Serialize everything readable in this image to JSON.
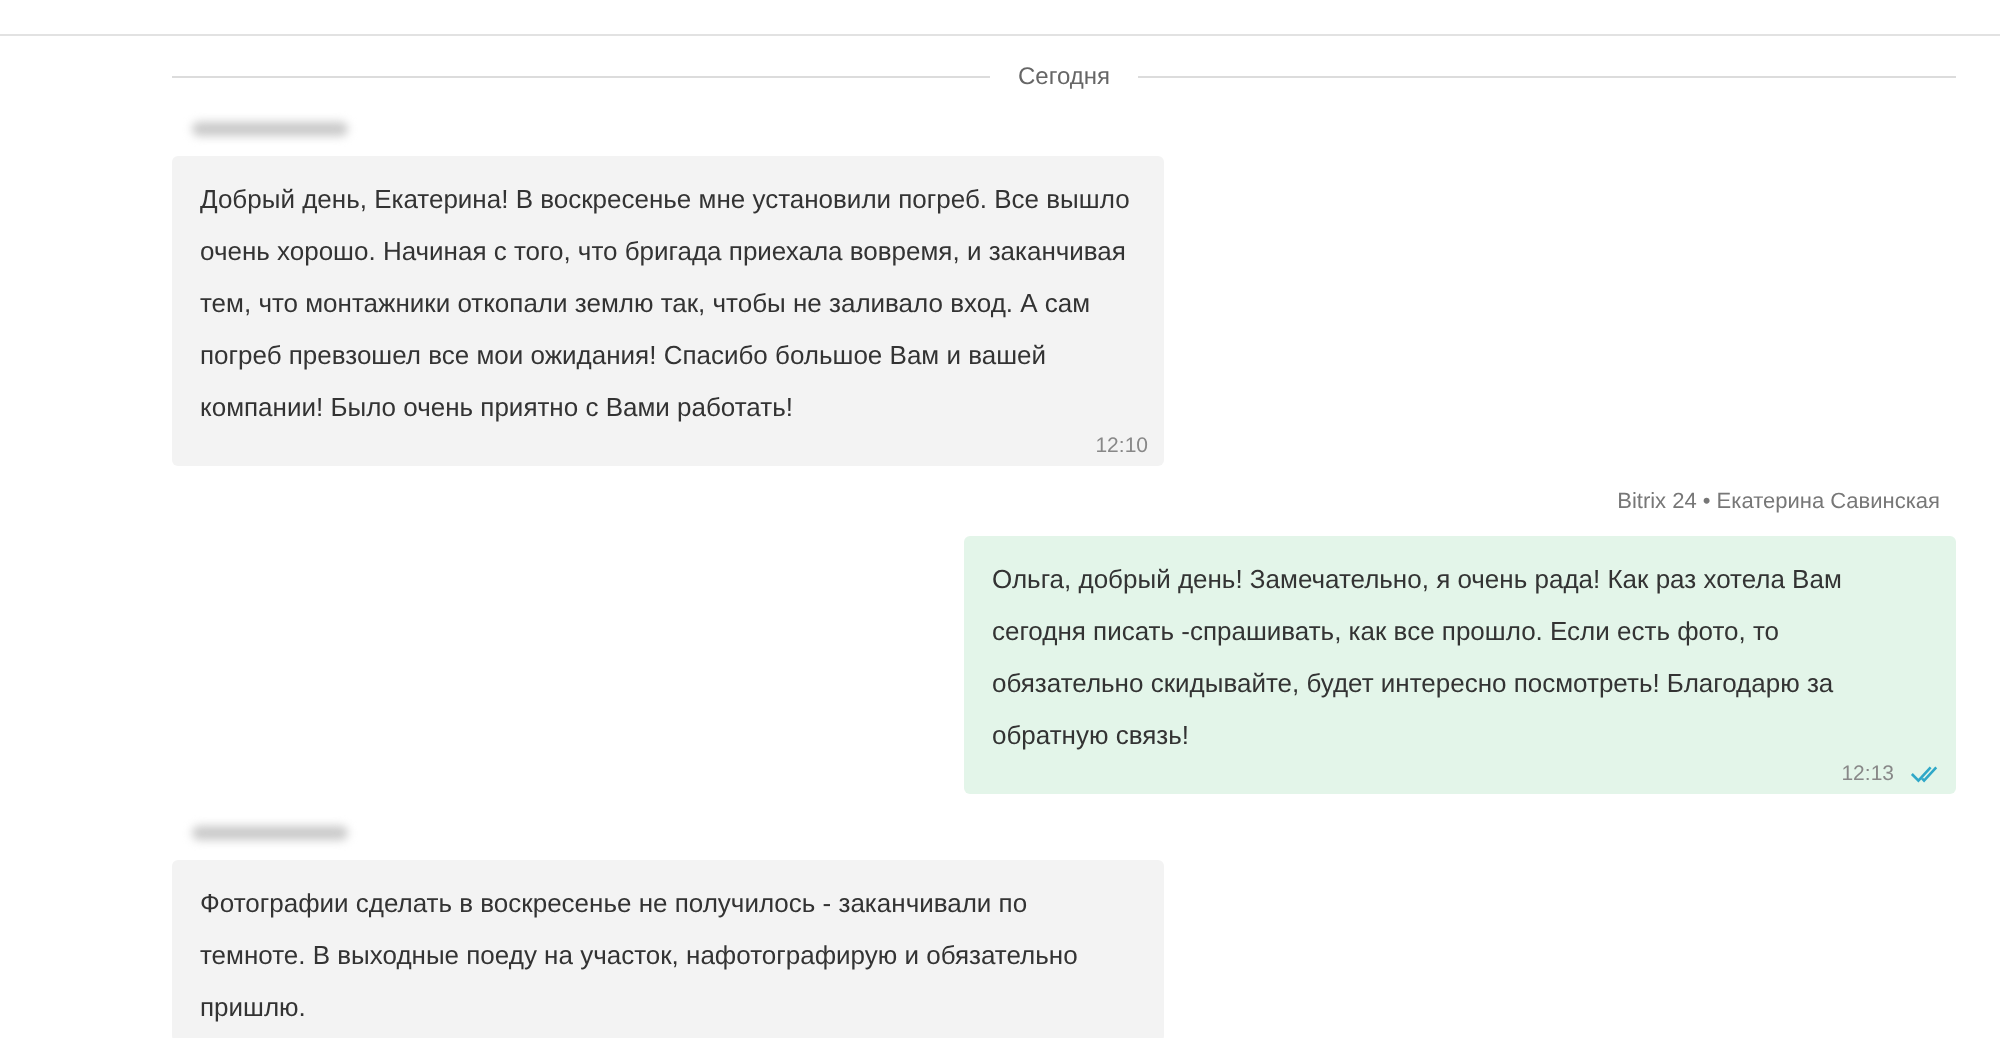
{
  "date_divider": "Сегодня",
  "messages": [
    {
      "kind": "incoming",
      "sender_blurred": true,
      "text": "Добрый день, Екатерина! В воскресенье мне установили погреб. Все вышло очень хорошо. Начиная с того, что бригада приехала вовремя, и заканчивая тем, что монтажники откопали землю так, чтобы не заливало вход. А сам погреб превзошел все мои ожидания! Спасибо большое Вам и вашей компании! Было очень приятно с Вами работать!",
      "time": "12:10"
    },
    {
      "kind": "outgoing",
      "author": "Bitrix 24 • Екатерина Савинская",
      "text": "Ольга, добрый день! Замечательно, я очень рада! Как раз хотела Вам сегодня писать -спрашивать, как все прошло. Если есть фото, то обязательно скидывайте, будет интересно посмотреть! Благодарю за обратную связь!",
      "time": "12:13",
      "read": true
    },
    {
      "kind": "incoming",
      "sender_blurred": true,
      "text": "Фотографии сделать в воскресенье не получилось - заканчивали по темноте. В выходные поеду на участок, нафотографирую и обязательно пришлю."
    }
  ]
}
